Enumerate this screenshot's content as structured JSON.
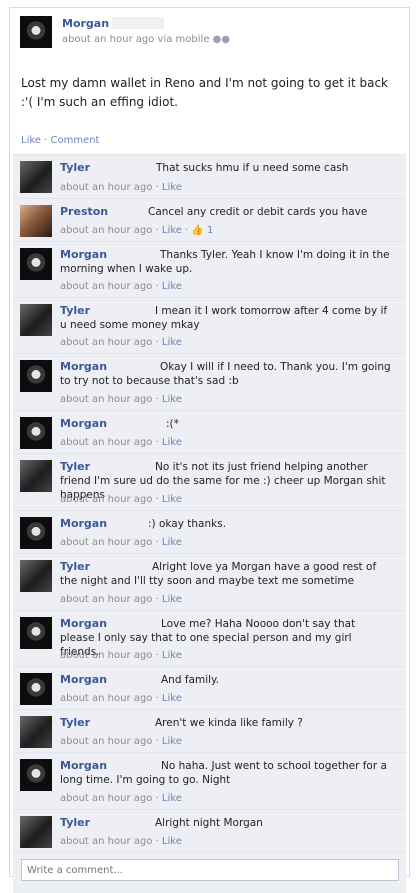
{
  "post": {
    "author": "Morgan",
    "timestamp": "about an hour ago",
    "via": "via mobile",
    "text": "Lost my damn wallet in Reno and I'm not going to get it back :'( I'm such an effing idiot.",
    "actions": "Like · Comment"
  },
  "comments": [
    {
      "name": "Tyler",
      "text": "That sucks hmu if u need some cash",
      "time": "about an hour ago",
      "like": "Like",
      "avatar": "tyler"
    },
    {
      "name": "Preston",
      "text": "Cancel any credit or debit cards you have",
      "time": "about an hour ago",
      "like": "Like",
      "likes_count": "1",
      "avatar": "preston"
    },
    {
      "name": "Morgan",
      "text": "Thanks Tyler. Yeah I know I'm doing it in the morning when I wake up.",
      "time": "about an hour ago",
      "like": "Like",
      "avatar": "morgan"
    },
    {
      "name": "Tyler",
      "text": "I mean it I work tomorrow after 4 come by if u need some money mkay",
      "time": "about an hour ago",
      "like": "Like",
      "avatar": "tyler"
    },
    {
      "name": "Morgan",
      "text": "Okay I will if I need to. Thank you. I'm going to try not to because that's sad :b",
      "time": "about an hour ago",
      "like": "Like",
      "avatar": "morgan"
    },
    {
      "name": "Morgan",
      "text": ":(*",
      "time": "about an hour ago",
      "like": "Like",
      "avatar": "morgan"
    },
    {
      "name": "Tyler",
      "text": "No it's not its just friend helping another friend I'm sure ud do the same for me :) cheer up Morgan shit happens",
      "time": "about an hour ago",
      "like": "Like",
      "avatar": "tyler"
    },
    {
      "name": "Morgan",
      "text": ":) okay thanks.",
      "time": "about an hour ago",
      "like": "Like",
      "avatar": "morgan"
    },
    {
      "name": "Tyler",
      "text": "Alright love ya Morgan have a good rest of the night and I'll tty soon and maybe text me sometime",
      "time": "about an hour ago",
      "like": "Like",
      "avatar": "tyler"
    },
    {
      "name": "Morgan",
      "text": "Love me? Haha Noooo don't say that please I only say that to one special person and my girl friends.",
      "time": "about an hour ago",
      "like": "Like",
      "avatar": "morgan"
    },
    {
      "name": "Morgan",
      "text": "And family.",
      "time": "about an hour ago",
      "like": "Like",
      "avatar": "morgan"
    },
    {
      "name": "Tyler",
      "text": "Aren't we kinda like family ?",
      "time": "about an hour ago",
      "like": "Like",
      "avatar": "tyler"
    },
    {
      "name": "Morgan",
      "text": "No haha. Just went to school together for a long time. I'm going to go. Night",
      "time": "about an hour ago",
      "like": "Like",
      "avatar": "morgan"
    },
    {
      "name": "Tyler",
      "text": "Alright night Morgan",
      "time": "about an hour ago",
      "like": "Like",
      "avatar": "tyler"
    }
  ],
  "write_comment": {
    "placeholder": "Write a comment..."
  }
}
